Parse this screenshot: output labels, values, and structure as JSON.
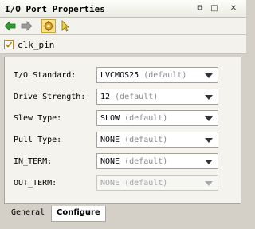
{
  "window": {
    "title": "I/O Port Properties",
    "buttons": {
      "restore": "⧉",
      "maximize": "□",
      "close": "✕"
    }
  },
  "toolbar": {
    "icons": [
      "back-arrow-icon",
      "forward-arrow-icon",
      "gear-icon",
      "pointer-icon"
    ]
  },
  "object": {
    "name": "clk_pin",
    "icon": "port-icon"
  },
  "fields": [
    {
      "label": "I/O Standard:",
      "value": "LVCMOS25",
      "default": "(default)",
      "enabled": true
    },
    {
      "label": "Drive Strength:",
      "value": "12",
      "default": "(default)",
      "enabled": true
    },
    {
      "label": "Slew Type:",
      "value": "SLOW",
      "default": "(default)",
      "enabled": true
    },
    {
      "label": "Pull Type:",
      "value": "NONE",
      "default": "(default)",
      "enabled": true
    },
    {
      "label": "IN_TERM:",
      "value": "NONE",
      "default": "(default)",
      "enabled": true
    },
    {
      "label": "OUT_TERM:",
      "value": "NONE",
      "default": "(default)",
      "enabled": false
    }
  ],
  "tabs": {
    "general": "General",
    "configure": "Configure"
  },
  "colors": {
    "accent": "#1c8f1c",
    "selected_tool": "#f8e38c"
  }
}
